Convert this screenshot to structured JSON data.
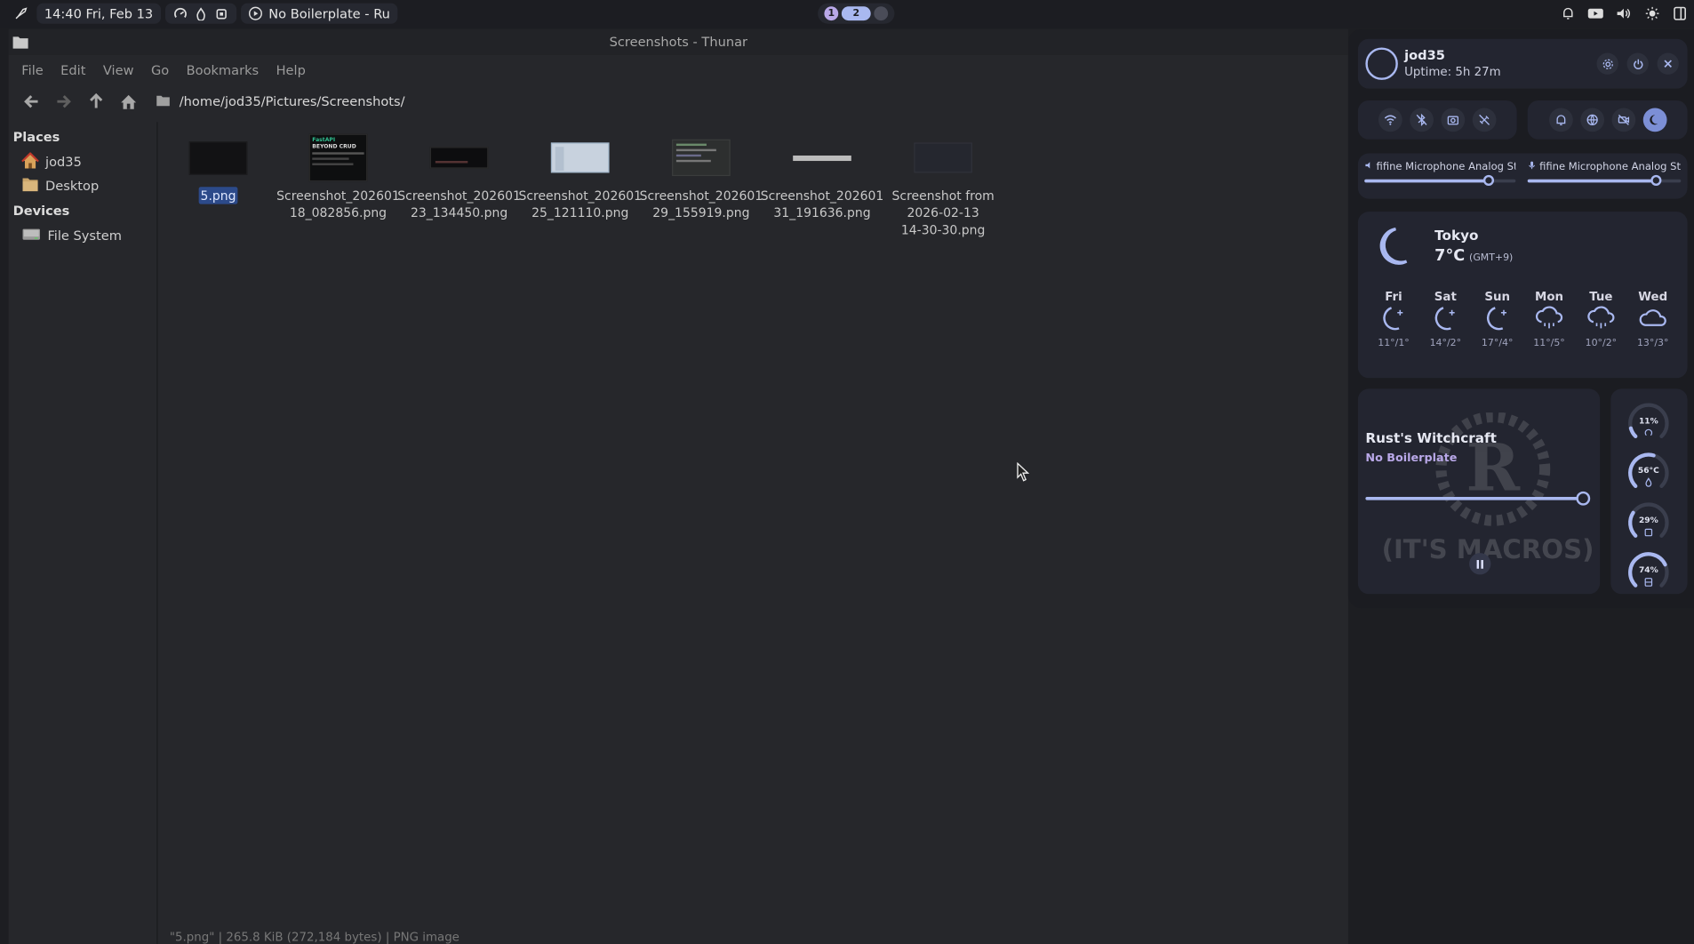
{
  "topbar": {
    "datetime": "14:40 Fri, Feb 13",
    "media_title": "No Boilerplate - Ru",
    "workspaces": [
      "1",
      "2"
    ]
  },
  "window": {
    "title": "Screenshots - Thunar",
    "menu": [
      "File",
      "Edit",
      "View",
      "Go",
      "Bookmarks",
      "Help"
    ],
    "path": "/home/jod35/Pictures/Screenshots/"
  },
  "sidebar": {
    "places_header": "Places",
    "places": [
      {
        "label": "jod35",
        "icon": "home-icon"
      },
      {
        "label": "Desktop",
        "icon": "folder-icon"
      }
    ],
    "devices_header": "Devices",
    "devices": [
      {
        "label": "File System",
        "icon": "drive-icon"
      }
    ]
  },
  "files": [
    {
      "name": "5.png",
      "selected": true
    },
    {
      "name": "Screenshot_20260118_082856.png",
      "line1": "Screenshot_202601",
      "line2": "18_082856.png"
    },
    {
      "name": "Screenshot_20260123_134450.png",
      "line1": "Screenshot_202601",
      "line2": "23_134450.png"
    },
    {
      "name": "Screenshot_20260125_121110.png",
      "line1": "Screenshot_202601",
      "line2": "25_121110.png"
    },
    {
      "name": "Screenshot_20260129_155919.png",
      "line1": "Screenshot_202601",
      "line2": "29_155919.png"
    },
    {
      "name": "Screenshot_20260131_191636.png",
      "line1": "Screenshot_202601",
      "line2": "31_191636.png"
    },
    {
      "name": "Screenshot from 2026-02-13 14-30-30.png",
      "line1": "Screenshot from",
      "line2": "2026-02-13",
      "line3": "14-30-30.png"
    }
  ],
  "thumb_text": {
    "header": "FastAPI",
    "title": "BEYOND CRUD"
  },
  "statusbar": "\"5.png\"  |  265.8 KiB (272,184 bytes)  |  PNG image",
  "panel": {
    "user": "jod35",
    "uptime": "Uptime: 5h 27m",
    "audio": [
      {
        "label": "fifine Microphone Analog St...",
        "level": 0.82
      },
      {
        "label": "fifine Microphone Analog St...",
        "level": 0.84
      }
    ],
    "weather": {
      "city": "Tokyo",
      "temp": "7°C",
      "tz": "(GMT+9)",
      "days": [
        {
          "day": "Fri",
          "range": "11°/1°",
          "icon": "moon-star-icon"
        },
        {
          "day": "Sat",
          "range": "14°/2°",
          "icon": "moon-star-icon"
        },
        {
          "day": "Sun",
          "range": "17°/4°",
          "icon": "moon-star-icon"
        },
        {
          "day": "Mon",
          "range": "11°/5°",
          "icon": "cloud-rain-icon"
        },
        {
          "day": "Tue",
          "range": "10°/2°",
          "icon": "cloud-rain-icon"
        },
        {
          "day": "Wed",
          "range": "13°/3°",
          "icon": "cloud-icon"
        }
      ]
    },
    "media": {
      "title": "Rust's Witchcraft",
      "artist": "No Boilerplate",
      "art_text": "(IT'S MACROS)",
      "progress": 0.98
    },
    "gauges": [
      {
        "label": "11%",
        "value": 0.11,
        "icon": "cpu-icon"
      },
      {
        "label": "56°C",
        "value": 0.56,
        "icon": "temp-icon"
      },
      {
        "label": "29%",
        "value": 0.29,
        "icon": "ram-icon"
      },
      {
        "label": "74%",
        "value": 0.74,
        "icon": "disk-icon"
      }
    ]
  },
  "colors": {
    "accent": "#a9b8f0",
    "selection": "#2c4a8a",
    "panel_bg": "#1b1c21",
    "card_bg": "#232530"
  }
}
